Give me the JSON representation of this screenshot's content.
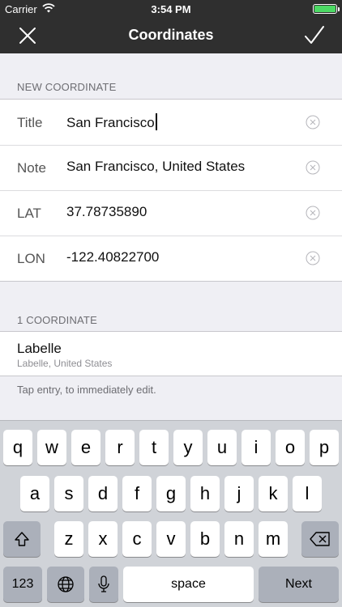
{
  "status_bar": {
    "carrier": "Carrier",
    "time": "3:54 PM"
  },
  "nav": {
    "title": "Coordinates",
    "close_icon": "close-icon",
    "done_icon": "checkmark-icon"
  },
  "new_section": {
    "header": "NEW COORDINATE",
    "rows": [
      {
        "label": "Title",
        "value": "San Francisco"
      },
      {
        "label": "Note",
        "value": "San Francisco, United States"
      },
      {
        "label": "LAT",
        "value": "37.78735890"
      },
      {
        "label": "LON",
        "value": "-122.40822700"
      }
    ]
  },
  "list_section": {
    "header": "1 COORDINATE",
    "items": [
      {
        "name": "Labelle",
        "subtitle": "Labelle, United States"
      }
    ],
    "footer": "Tap entry, to immediately edit."
  },
  "keyboard": {
    "row1": [
      "q",
      "w",
      "e",
      "r",
      "t",
      "y",
      "u",
      "i",
      "o",
      "p"
    ],
    "row2": [
      "a",
      "s",
      "d",
      "f",
      "g",
      "h",
      "j",
      "k",
      "l"
    ],
    "row3": [
      "z",
      "x",
      "c",
      "v",
      "b",
      "n",
      "m"
    ],
    "numbers_key": "123",
    "space_key": "space",
    "return_key": "Next"
  }
}
